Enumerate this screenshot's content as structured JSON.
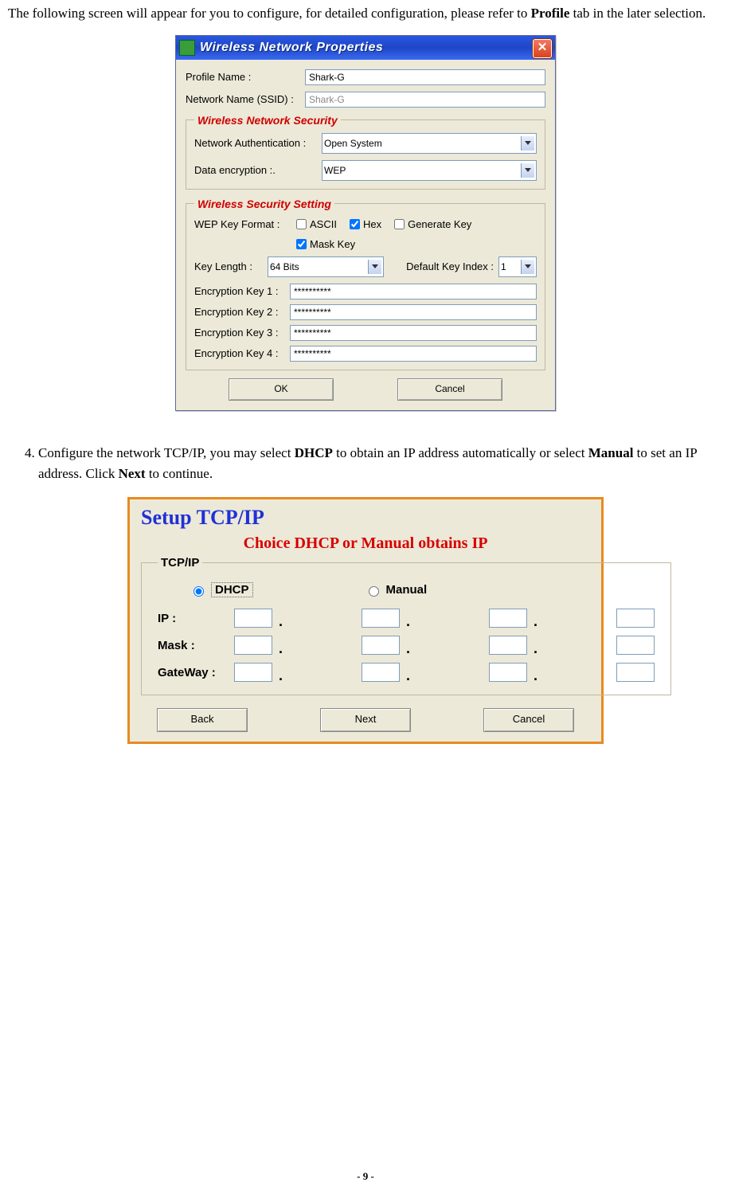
{
  "intro": {
    "pre": "The following screen will appear for you to configure, for detailed configuration, please refer to ",
    "bold": "Profile",
    "post": " tab in the later selection."
  },
  "dialog1": {
    "title": "Wireless Network Properties",
    "profile_name_label": "Profile Name :",
    "profile_name_value": "Shark-G",
    "ssid_label": "Network Name (SSID) :",
    "ssid_value": "Shark-G",
    "sec_legend": "Wireless Network Security",
    "auth_label": "Network Authentication :",
    "auth_value": "Open System",
    "enc_label": "Data encryption :.",
    "enc_value": "WEP",
    "setting_legend": "Wireless Security Setting",
    "wep_format_label": "WEP Key Format :",
    "ascii_label": "ASCII",
    "hex_label": "Hex",
    "generate_label": "Generate Key",
    "mask_label": "Mask Key",
    "key_length_label": "Key Length :",
    "key_length_value": "64 Bits",
    "default_index_label": "Default Key Index :",
    "default_index_value": "1",
    "k1_label": "Encryption Key 1 :",
    "k2_label": "Encryption Key 2 :",
    "k3_label": "Encryption Key 3 :",
    "k4_label": "Encryption Key 4 :",
    "key_mask_value": "**********",
    "ok_label": "OK",
    "cancel_label": "Cancel"
  },
  "step4": {
    "number": "4.",
    "pre": "Configure the network TCP/IP, you may select ",
    "b1": "DHCP",
    "mid1": " to obtain an IP address automatically or select ",
    "b2": "Manual",
    "mid2": " to set an IP address. Click ",
    "b3": "Next",
    "post": " to continue."
  },
  "dialog2": {
    "title": "Setup TCP/IP",
    "subtitle": "Choice DHCP or Manual  obtains IP",
    "legend": "TCP/IP",
    "dhcp_label": "DHCP",
    "manual_label": "Manual",
    "ip_label": "IP :",
    "mask_label": "Mask :",
    "gateway_label": "GateWay :",
    "back_label": "Back",
    "next_label": "Next",
    "cancel_label": "Cancel"
  },
  "page_number": "- 9 -"
}
